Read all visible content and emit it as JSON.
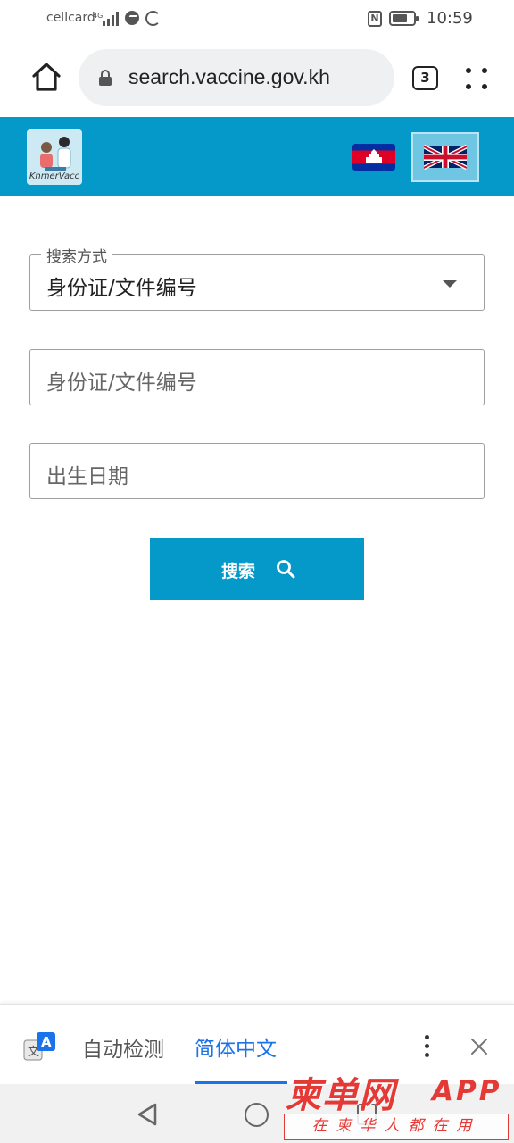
{
  "status_bar": {
    "carrier": "cellcard",
    "time": "10:59",
    "icons": [
      "signal-icon",
      "messenger-icon",
      "sync-icon",
      "nfc-icon",
      "battery-icon"
    ]
  },
  "browser": {
    "url": "search.vaccine.gov.kh",
    "tab_count": "3",
    "icons": [
      "home-icon",
      "lock-icon",
      "tabs-icon",
      "more-menu-icon"
    ]
  },
  "site_header": {
    "logo_text": "KhmerVacc",
    "background": "#0599c9",
    "languages": [
      "khmer-flag",
      "english-flag"
    ],
    "selected_language": "english-flag"
  },
  "form": {
    "search_method": {
      "legend": "搜索方式",
      "value": "身份证/文件编号"
    },
    "id_field": {
      "placeholder": "身份证/文件编号"
    },
    "dob_field": {
      "placeholder": "出生日期"
    },
    "search_button": {
      "label": "搜索",
      "icon": "search-icon"
    }
  },
  "translate_bar": {
    "source": "自动检测",
    "target": "简体中文",
    "accent": "#1a73e8",
    "icons": [
      "translate-icon",
      "more-vert-icon",
      "close-icon"
    ]
  },
  "watermark": {
    "brand": "柬单网",
    "app": "APP",
    "slogan": "在柬华人都在用",
    "color": "#e53935"
  }
}
